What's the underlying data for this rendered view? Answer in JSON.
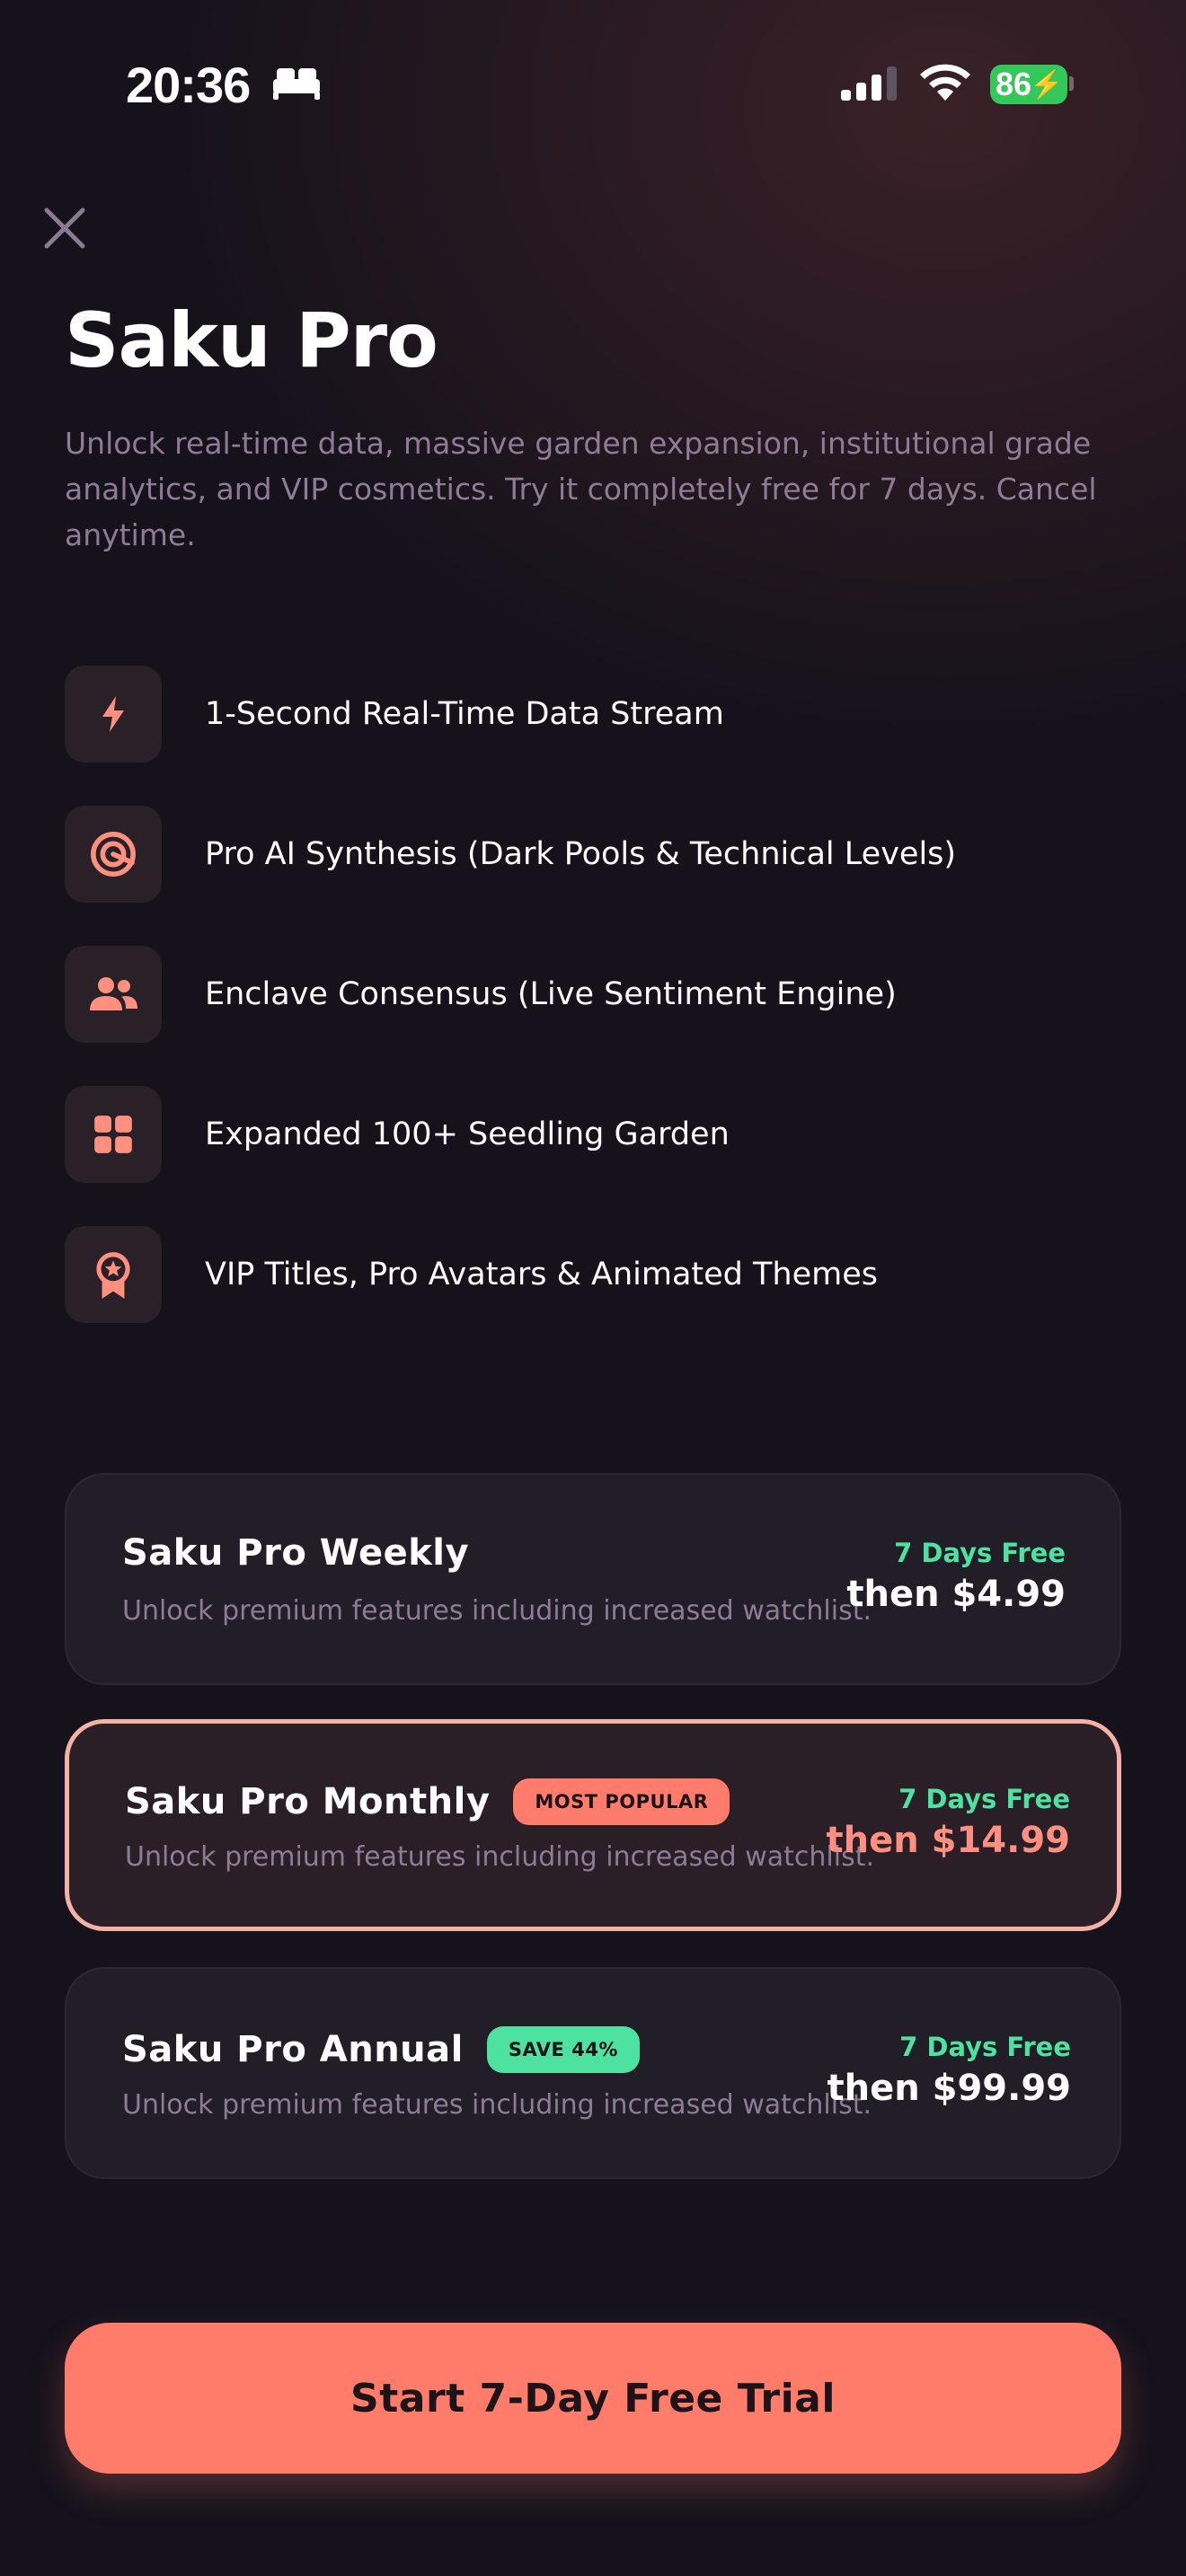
{
  "status_bar": {
    "time": "20:36",
    "battery": "86"
  },
  "header": {
    "title": "Saku Pro",
    "subtitle": "Unlock real-time data, massive garden expansion, institutional grade analytics, and VIP cosmetics. Try it completely free for 7 days. Cancel anytime."
  },
  "features": [
    {
      "icon": "bolt-icon",
      "label": "1-Second Real-Time Data Stream"
    },
    {
      "icon": "target-icon",
      "label": "Pro AI Synthesis (Dark Pools & Technical Levels)"
    },
    {
      "icon": "people-icon",
      "label": "Enclave Consensus (Live Sentiment Engine)"
    },
    {
      "icon": "grid-icon",
      "label": "Expanded 100+ Seedling Garden"
    },
    {
      "icon": "badge-star-icon",
      "label": "VIP Titles, Pro Avatars & Animated Themes"
    }
  ],
  "plans": [
    {
      "name": "Saku Pro Weekly",
      "badge": "",
      "description": "Unlock premium features including increased watchlist.",
      "trial": "7 Days Free",
      "price": "then $4.99",
      "selected": false
    },
    {
      "name": "Saku Pro Monthly",
      "badge": "MOST POPULAR",
      "description": "Unlock premium features including increased watchlist.",
      "trial": "7 Days Free",
      "price": "then $14.99",
      "selected": true
    },
    {
      "name": "Saku Pro Annual",
      "badge": "SAVE 44%",
      "description": "Unlock premium features including increased watchlist.",
      "trial": "7 Days Free",
      "price": "then $99.99",
      "selected": false
    }
  ],
  "cta": {
    "label": "Start 7-Day Free Trial"
  },
  "colors": {
    "accent": "#ff7b6a",
    "green": "#4ee2a0",
    "selected_border": "#f6b1a6",
    "muted_text": "#8f7b96"
  }
}
